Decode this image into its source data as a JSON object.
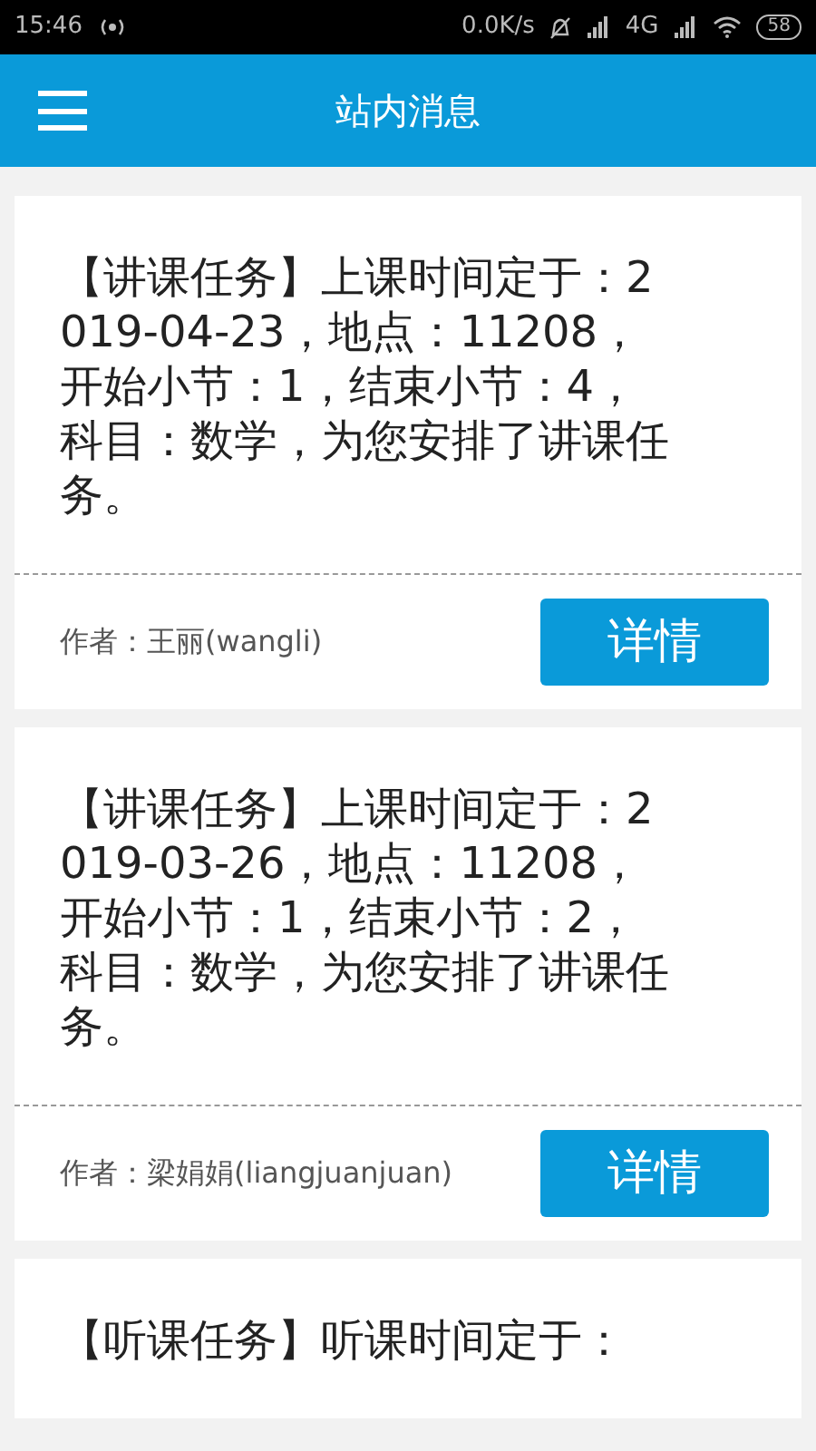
{
  "status_bar": {
    "time": "15:46",
    "speed": "0.0K/s",
    "network": "4G",
    "battery": "58"
  },
  "header": {
    "title": "站内消息"
  },
  "messages": [
    {
      "text": "【讲课任务】上课时间定于：2019-04-23，地点：11208，开始小节：1，结束小节：4，科目：数学，为您安排了讲课任务。",
      "author": "作者：王丽(wangli)",
      "button": "详情"
    },
    {
      "text": "【讲课任务】上课时间定于：2019-03-26，地点：11208，开始小节：1，结束小节：2，科目：数学，为您安排了讲课任务。",
      "author": "作者：梁娟娟(liangjuanjuan)",
      "button": "详情"
    },
    {
      "text": "【听课任务】听课时间定于："
    }
  ]
}
